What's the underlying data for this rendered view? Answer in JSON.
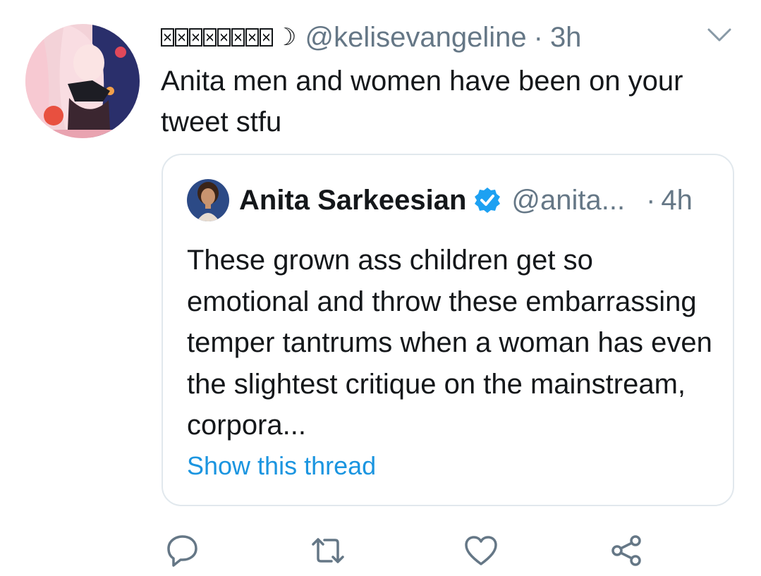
{
  "tweet": {
    "display_name_suffix": "☽",
    "handle": "@kelisevangeline",
    "separator": "·",
    "time": "3h",
    "text": "Anita men and women have been on your tweet stfu",
    "avatar_icon": "anime-avatar",
    "menu_icon": "chevron-down-icon"
  },
  "quoted": {
    "name": "Anita Sarkeesian",
    "handle": "@anita...",
    "separator": "·",
    "time": "4h",
    "text": "These grown ass children get so emotional and throw these embarrassing temper tantrums when a woman has even the slightest critique on the mainstream, corpora...",
    "link": "Show this thread",
    "verified_icon": "verified-badge-icon"
  },
  "actions": [
    {
      "icon": "reply-icon"
    },
    {
      "icon": "retweet-icon"
    },
    {
      "icon": "like-icon"
    },
    {
      "icon": "share-icon"
    }
  ],
  "colors": {
    "text": "#14171a",
    "secondary": "#657786",
    "link": "#1b95e0",
    "verified": "#1da1f2",
    "border": "#e1e8ed"
  }
}
